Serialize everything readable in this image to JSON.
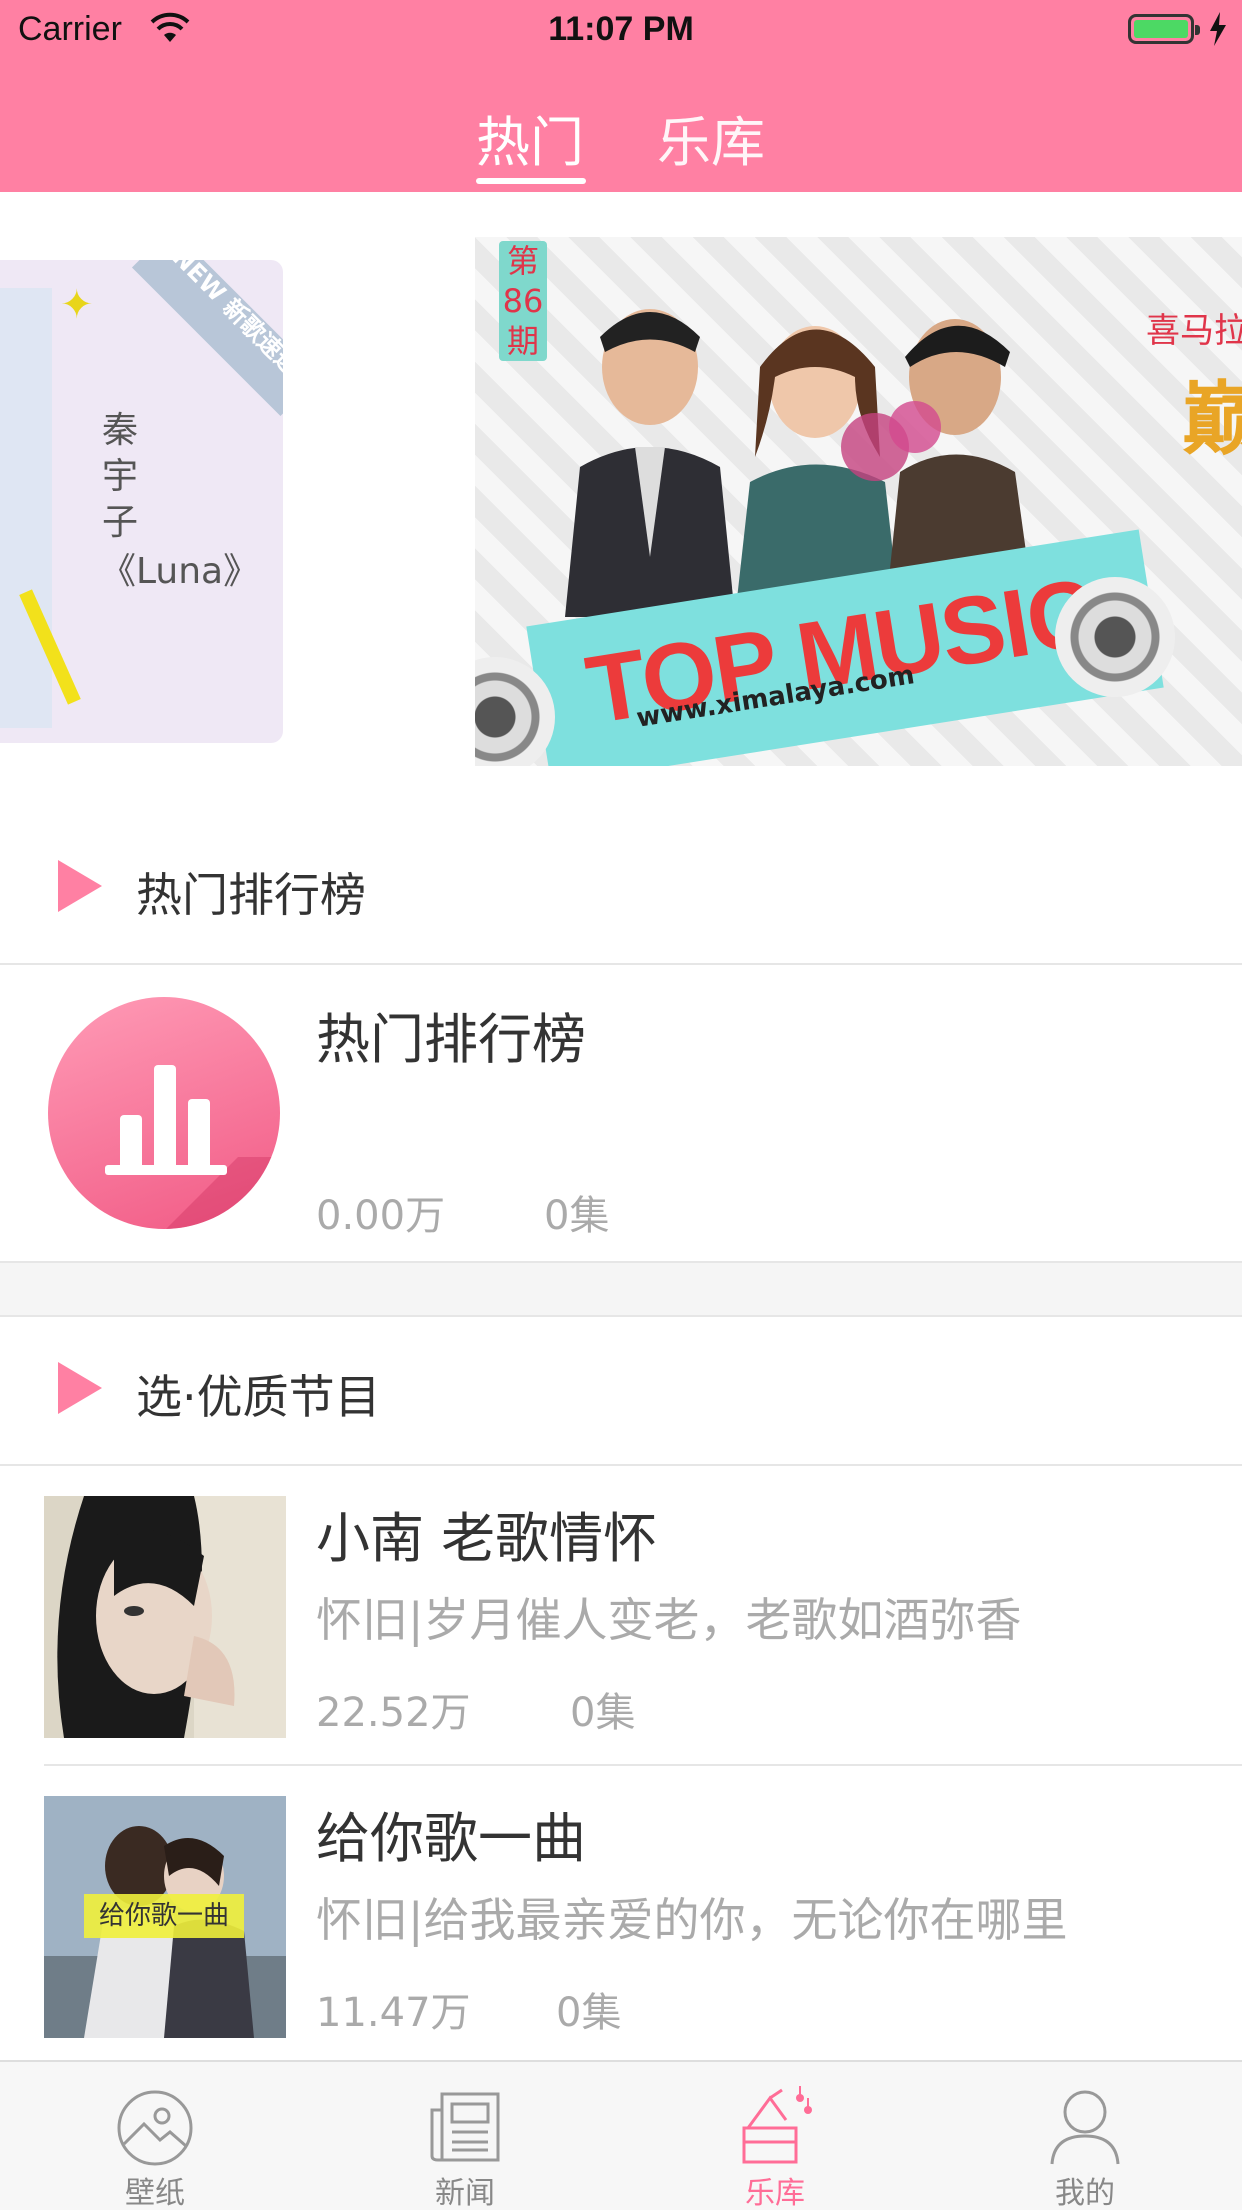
{
  "status_bar": {
    "carrier": "Carrier",
    "time": "11:07 PM"
  },
  "top_tabs": [
    {
      "label": "热门",
      "active": true
    },
    {
      "label": "乐库",
      "active": false
    }
  ],
  "banners": {
    "left": {
      "badge": "NEW 新歌速递",
      "artist": "秦宇子",
      "song": "《Luna》"
    },
    "right": {
      "issue": "第86期",
      "headline": "TOP MUSIC",
      "url": "www.ximalaya.com",
      "brand": "喜马拉",
      "peak": "巅"
    }
  },
  "sections": {
    "hot_ranking": {
      "title": "热门排行榜"
    },
    "quality": {
      "title": "选·优质节目"
    }
  },
  "rank_card": {
    "title": "热门排行榜",
    "plays": "0.00万",
    "episodes": "0集"
  },
  "programs": [
    {
      "title": "小南 老歌情怀",
      "desc": "怀旧|岁月催人变老，老歌如酒弥香",
      "plays": "22.52万",
      "episodes": "0集"
    },
    {
      "title": "给你歌一曲",
      "desc": "怀旧|给我最亲爱的你，无论你在哪里",
      "plays": "11.47万",
      "episodes": "0集",
      "thumb_text": "给你歌一曲"
    }
  ],
  "tab_bar": [
    {
      "label": "壁纸",
      "icon": "wallpaper-icon",
      "active": false
    },
    {
      "label": "新闻",
      "icon": "news-icon",
      "active": false
    },
    {
      "label": "乐库",
      "icon": "music-library-icon",
      "active": true
    },
    {
      "label": "我的",
      "icon": "profile-icon",
      "active": false
    }
  ],
  "colors": {
    "brand": "#ff80a3",
    "active_tab": "#ff6d97",
    "meta_text": "#aaaaaa"
  }
}
